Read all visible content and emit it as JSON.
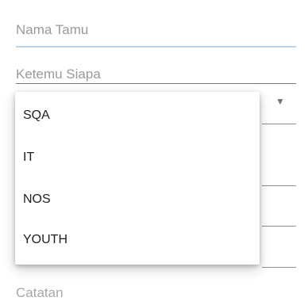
{
  "form": {
    "nama_tamu": {
      "placeholder": "Nama Tamu"
    },
    "ketemu_siapa": {
      "placeholder": "Ketemu Siapa"
    },
    "catatan": {
      "placeholder": "Catatan"
    }
  },
  "dropdown": {
    "icon": "dropdown-arrow-icon",
    "arrow_glyph": "▼",
    "options": [
      "SQA",
      "IT",
      "NOS",
      "YOUTH"
    ]
  },
  "colors": {
    "focus_underline": "#b9d8ee",
    "placeholder": "#9e9e9e",
    "text": "#212121"
  }
}
